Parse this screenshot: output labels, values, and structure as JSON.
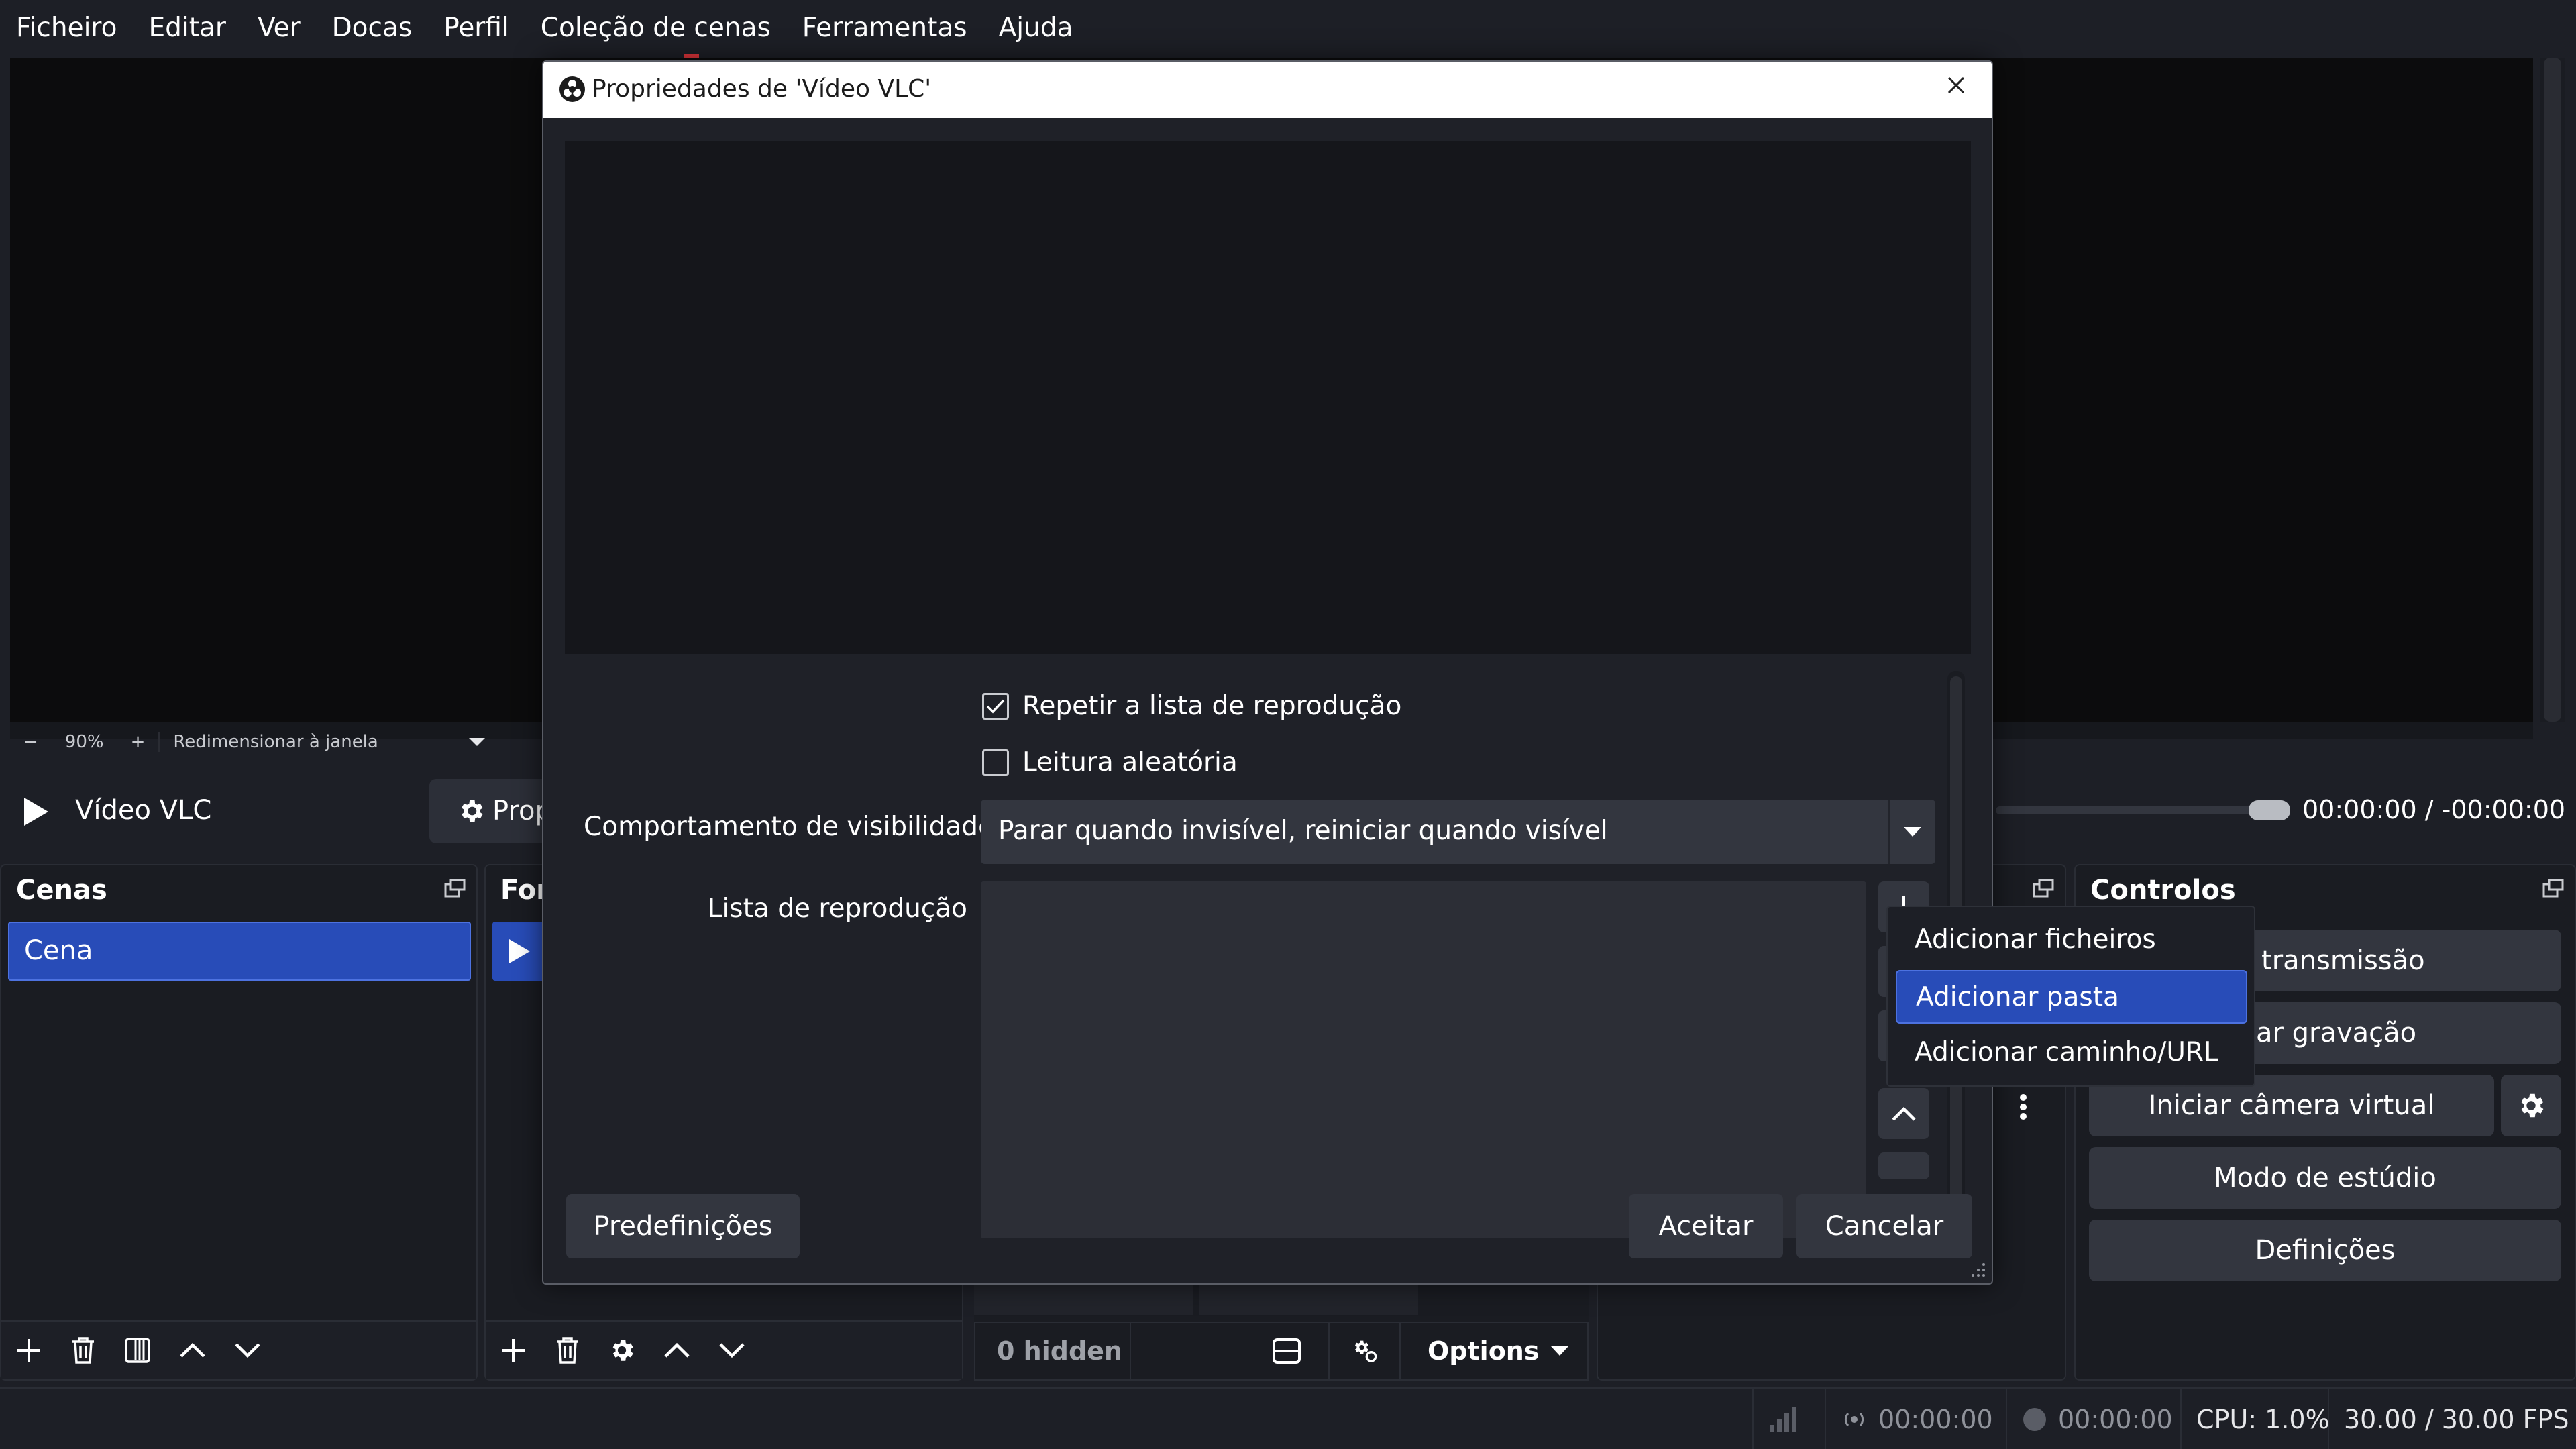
{
  "menu": [
    "Ficheiro",
    "Editar",
    "Ver",
    "Docas",
    "Perfil",
    "Coleção de cenas",
    "Ferramentas",
    "Ajuda"
  ],
  "zoom": {
    "minus": "−",
    "value": "90%",
    "plus": "+",
    "mode": "Redimensionar à janela"
  },
  "source_toolbar": {
    "source_name": "Vídeo VLC",
    "properties_label": "Prop",
    "time_current": "00:00:00",
    "time_separator": "/",
    "time_remaining": "-00:00:00"
  },
  "scenes_dock": {
    "title": "Cenas",
    "items": [
      "Cena"
    ]
  },
  "sources_dock": {
    "title": "For"
  },
  "mixer": {
    "hidden": "0 hidden",
    "options": "Options"
  },
  "controls_dock": {
    "title": "Controlos",
    "buttons": [
      "ar transmissão",
      "ciar gravação",
      "Iniciar câmera virtual",
      "Modo de estúdio",
      "Definições"
    ]
  },
  "status": {
    "stream_time": "00:00:00",
    "record_time": "00:00:00",
    "cpu": "CPU: 1.0%",
    "fps": "30.00 / 30.00 FPS"
  },
  "dialog": {
    "title": "Propriedades de 'Vídeo VLC'",
    "loop_label": "Repetir a lista de reprodução",
    "loop_checked": true,
    "shuffle_label": "Leitura aleatória",
    "shuffle_checked": false,
    "visibility_label": "Comportamento de visibilidade",
    "visibility_value": "Parar quando invisível, reiniciar quando visível",
    "playlist_label": "Lista de reprodução",
    "presets_button": "Predefinições",
    "accept_button": "Aceitar",
    "cancel_button": "Cancelar"
  },
  "add_menu": {
    "items": [
      "Adicionar ficheiros",
      "Adicionar pasta",
      "Adicionar caminho/URL"
    ],
    "highlighted_index": 1
  },
  "colors": {
    "accent": "#284cb8",
    "background": "#1d1f26",
    "panel": "#33363f"
  }
}
